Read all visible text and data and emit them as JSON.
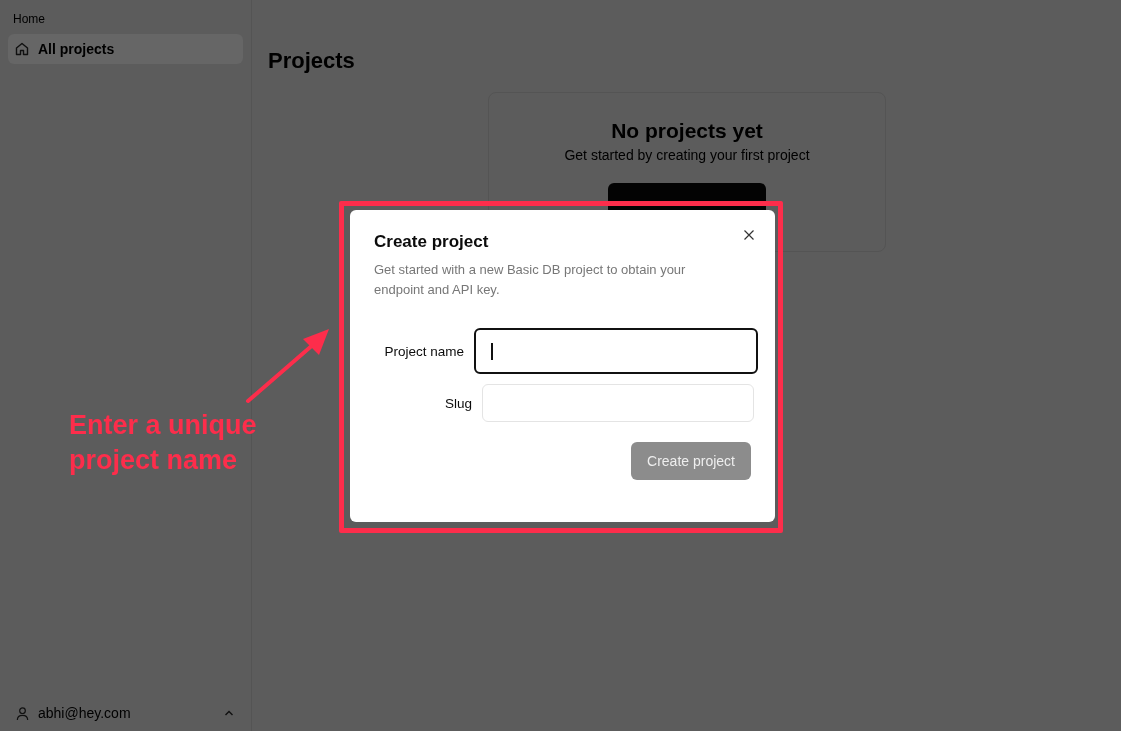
{
  "sidebar": {
    "section_label": "Home",
    "items": [
      {
        "label": "All projects",
        "selected": true
      }
    ],
    "user": "abhi@hey.com"
  },
  "main": {
    "title": "Projects",
    "empty_state": {
      "title": "No projects yet",
      "subtitle": "Get started by creating your first project"
    }
  },
  "dialog": {
    "title": "Create project",
    "description": "Get started with a new Basic DB project to obtain your endpoint and API key.",
    "fields": [
      {
        "label": "Project name",
        "focused": true
      },
      {
        "label": "Slug",
        "focused": false
      }
    ],
    "submit_button": {
      "label": "Create project",
      "disabled": true
    }
  },
  "annotation": {
    "text": "Enter a unique project name"
  }
}
